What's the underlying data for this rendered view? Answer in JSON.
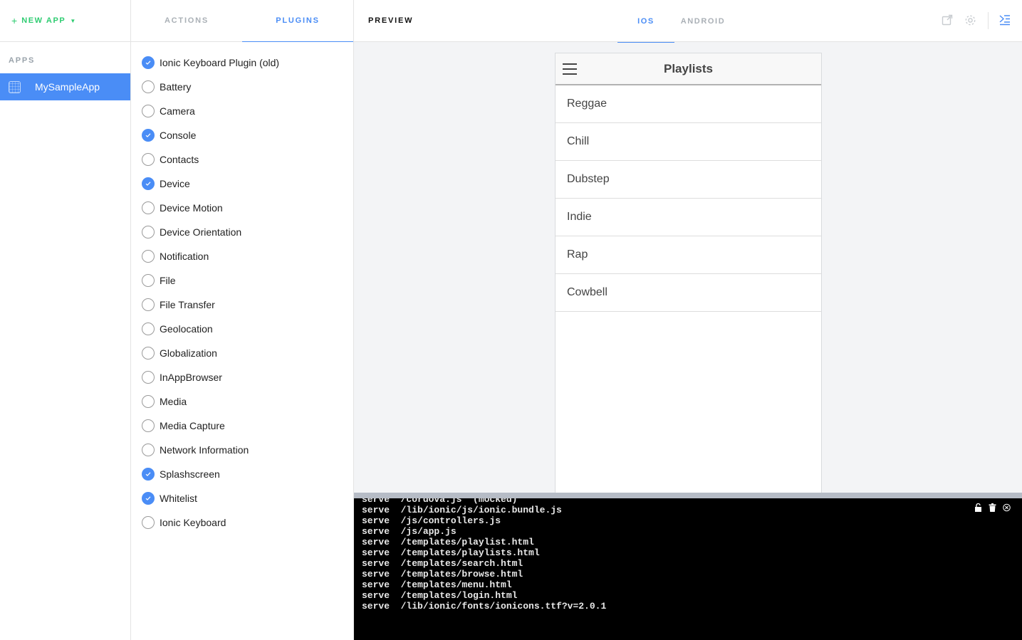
{
  "sidebar": {
    "new_app_plus": "+",
    "new_app_label": "NEW APP",
    "new_app_caret": "▼",
    "apps_label": "APPS",
    "selected_app": "MySampleApp"
  },
  "plugin_panel": {
    "tabs": [
      {
        "label": "ACTIONS",
        "active": false
      },
      {
        "label": "PLUGINS",
        "active": true
      }
    ],
    "plugins": [
      {
        "label": "Ionic Keyboard Plugin (old)",
        "checked": true
      },
      {
        "label": "Battery",
        "checked": false
      },
      {
        "label": "Camera",
        "checked": false
      },
      {
        "label": "Console",
        "checked": true
      },
      {
        "label": "Contacts",
        "checked": false
      },
      {
        "label": "Device",
        "checked": true
      },
      {
        "label": "Device Motion",
        "checked": false
      },
      {
        "label": "Device Orientation",
        "checked": false
      },
      {
        "label": "Notification",
        "checked": false
      },
      {
        "label": "File",
        "checked": false
      },
      {
        "label": "File Transfer",
        "checked": false
      },
      {
        "label": "Geolocation",
        "checked": false
      },
      {
        "label": "Globalization",
        "checked": false
      },
      {
        "label": "InAppBrowser",
        "checked": false
      },
      {
        "label": "Media",
        "checked": false
      },
      {
        "label": "Media Capture",
        "checked": false
      },
      {
        "label": "Network Information",
        "checked": false
      },
      {
        "label": "Splashscreen",
        "checked": true
      },
      {
        "label": "Whitelist",
        "checked": true
      },
      {
        "label": "Ionic Keyboard",
        "checked": false
      }
    ]
  },
  "preview": {
    "label": "PREVIEW",
    "os_tabs": [
      {
        "label": "IOS",
        "active": true
      },
      {
        "label": "ANDROID",
        "active": false
      }
    ],
    "header_icons": [
      "external-link-icon",
      "gear-icon",
      "collapse-panel-icon"
    ],
    "accent_color": "#4a8df6"
  },
  "device": {
    "title": "Playlists",
    "items": [
      "Reggae",
      "Chill",
      "Dubstep",
      "Indie",
      "Rap",
      "Cowbell"
    ]
  },
  "console": {
    "lines": [
      "serve  /cordova.js  (mocked)",
      "serve  /lib/ionic/js/ionic.bundle.js",
      "serve  /js/controllers.js",
      "serve  /js/app.js",
      "serve  /templates/playlist.html",
      "serve  /templates/playlists.html",
      "serve  /templates/search.html",
      "serve  /templates/browse.html",
      "serve  /templates/menu.html",
      "serve  /templates/login.html",
      "serve  /lib/ionic/fonts/ionicons.ttf?v=2.0.1"
    ],
    "tools": [
      "unlock-icon",
      "trash-icon",
      "close-circle-icon"
    ]
  }
}
